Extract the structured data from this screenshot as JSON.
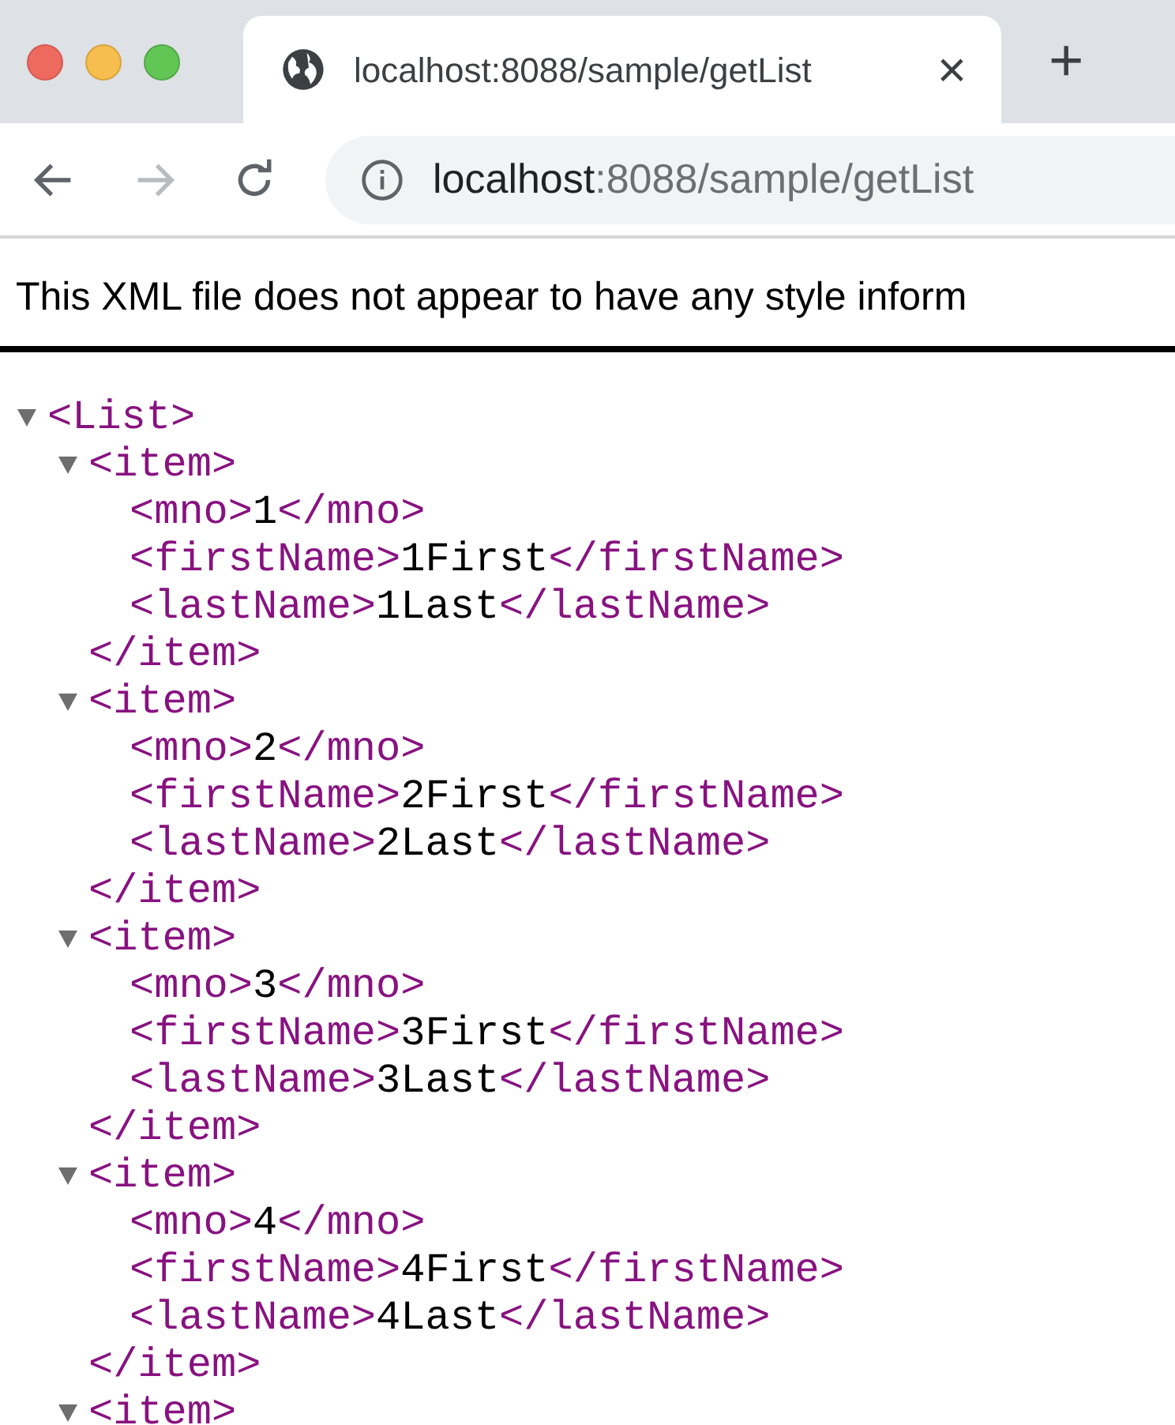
{
  "tab": {
    "title": "localhost:8088/sample/getList",
    "close": "×",
    "new_tab": "+"
  },
  "address_bar": {
    "host": "localhost",
    "path": ":8088/sample/getList"
  },
  "navigation": {
    "back_disabled": false,
    "forward_disabled": true
  },
  "notice": "This XML file does not appear to have any style inform",
  "xml_tree": {
    "open_tag": "<List>",
    "expanded": true,
    "children": [
      {
        "kind": "element",
        "open_tag": "<item>",
        "close_tag": "</item>",
        "expanded": true,
        "children": [
          {
            "open_tag": "<mno>",
            "value": "1",
            "close_tag": "</mno>"
          },
          {
            "open_tag": "<firstName>",
            "value": "1First",
            "close_tag": "</firstName>"
          },
          {
            "open_tag": "<lastName>",
            "value": "1Last",
            "close_tag": "</lastName>"
          }
        ]
      },
      {
        "kind": "element",
        "open_tag": "<item>",
        "close_tag": "</item>",
        "expanded": true,
        "children": [
          {
            "open_tag": "<mno>",
            "value": "2",
            "close_tag": "</mno>"
          },
          {
            "open_tag": "<firstName>",
            "value": "2First",
            "close_tag": "</firstName>"
          },
          {
            "open_tag": "<lastName>",
            "value": "2Last",
            "close_tag": "</lastName>"
          }
        ]
      },
      {
        "kind": "element",
        "open_tag": "<item>",
        "close_tag": "</item>",
        "expanded": true,
        "children": [
          {
            "open_tag": "<mno>",
            "value": "3",
            "close_tag": "</mno>"
          },
          {
            "open_tag": "<firstName>",
            "value": "3First",
            "close_tag": "</firstName>"
          },
          {
            "open_tag": "<lastName>",
            "value": "3Last",
            "close_tag": "</lastName>"
          }
        ]
      },
      {
        "kind": "element",
        "open_tag": "<item>",
        "close_tag": "</item>",
        "expanded": true,
        "children": [
          {
            "open_tag": "<mno>",
            "value": "4",
            "close_tag": "</mno>"
          },
          {
            "open_tag": "<firstName>",
            "value": "4First",
            "close_tag": "</firstName>"
          },
          {
            "open_tag": "<lastName>",
            "value": "4Last",
            "close_tag": "</lastName>"
          }
        ]
      },
      {
        "kind": "element",
        "open_tag": "<item>",
        "expanded": true
      }
    ]
  }
}
